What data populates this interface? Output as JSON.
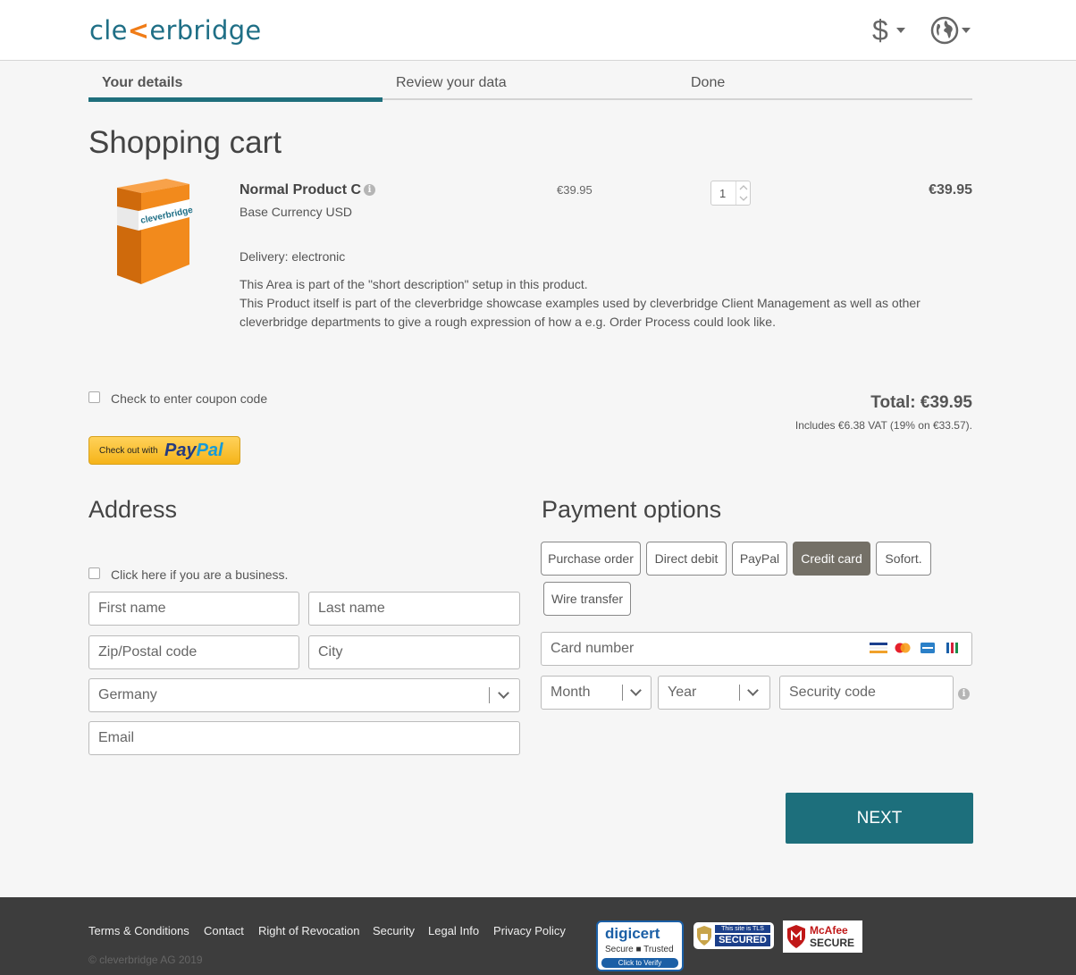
{
  "header": {
    "logo_pre": "cle",
    "logo_accent": "<",
    "logo_post": "erbridge",
    "currency_symbol": "$",
    "currency_icon": "dollar-icon",
    "language_icon": "globe-icon"
  },
  "steps": {
    "step1": "Your details",
    "step2": "Review your data",
    "step3": "Done",
    "active": 1
  },
  "cart": {
    "title": "Shopping cart",
    "product_name": "Normal Product C",
    "currency_note": "Base Currency USD",
    "delivery": "Delivery: electronic",
    "unit_price": "€39.95",
    "quantity": "1",
    "line_total": "€39.95",
    "desc1": "This Area is part of the \"short description\" setup in this product.",
    "desc2": "This Product itself is part of the cleverbridge showcase examples used by cleverbridge Client Management as well as other cleverbridge departments to give a rough expression of how a e.g. Order Process could look like.",
    "box_brand": "cleverbridge",
    "coupon_label": "Check to enter coupon code",
    "total": "Total: €39.95",
    "vat_note": "Includes €6.38 VAT (19% on €33.57).",
    "paypal_small": "Check out with",
    "paypal_brand1": "Pay",
    "paypal_brand2": "Pal"
  },
  "address": {
    "title": "Address",
    "business_label": "Click here if you are a business.",
    "first_name": "First name",
    "last_name": "Last name",
    "zip": "Zip/Postal code",
    "city": "City",
    "country": "Germany",
    "email": "Email"
  },
  "payment": {
    "title": "Payment options",
    "options": [
      "Purchase order",
      "Direct debit",
      "PayPal",
      "Credit card",
      "Sofort.",
      "Wire transfer"
    ],
    "selected": "Credit card",
    "card_number": "Card number",
    "month": "Month",
    "year": "Year",
    "security_code": "Security code"
  },
  "next_label": "NEXT",
  "footer": {
    "links": [
      "Terms & Conditions",
      "Contact",
      "Right of Revocation",
      "Security",
      "Legal Info",
      "Privacy Policy"
    ],
    "copyright": "© cleverbridge AG 2019",
    "badge1_top": "digicert",
    "badge1_mid": "Secure",
    "badge1_mid2": "Trusted",
    "badge1_bottom": "Click to Verify",
    "badge2_top": "This site is TLS",
    "badge2_bottom": "SECURED",
    "badge3_top": "McAfee",
    "badge3_bottom": "SECURE"
  },
  "colors": {
    "accent": "#1d6f7c",
    "selected_payment": "#747067",
    "paypal_yellow": "#ffc439",
    "footer_bg": "#3d3d3d"
  }
}
